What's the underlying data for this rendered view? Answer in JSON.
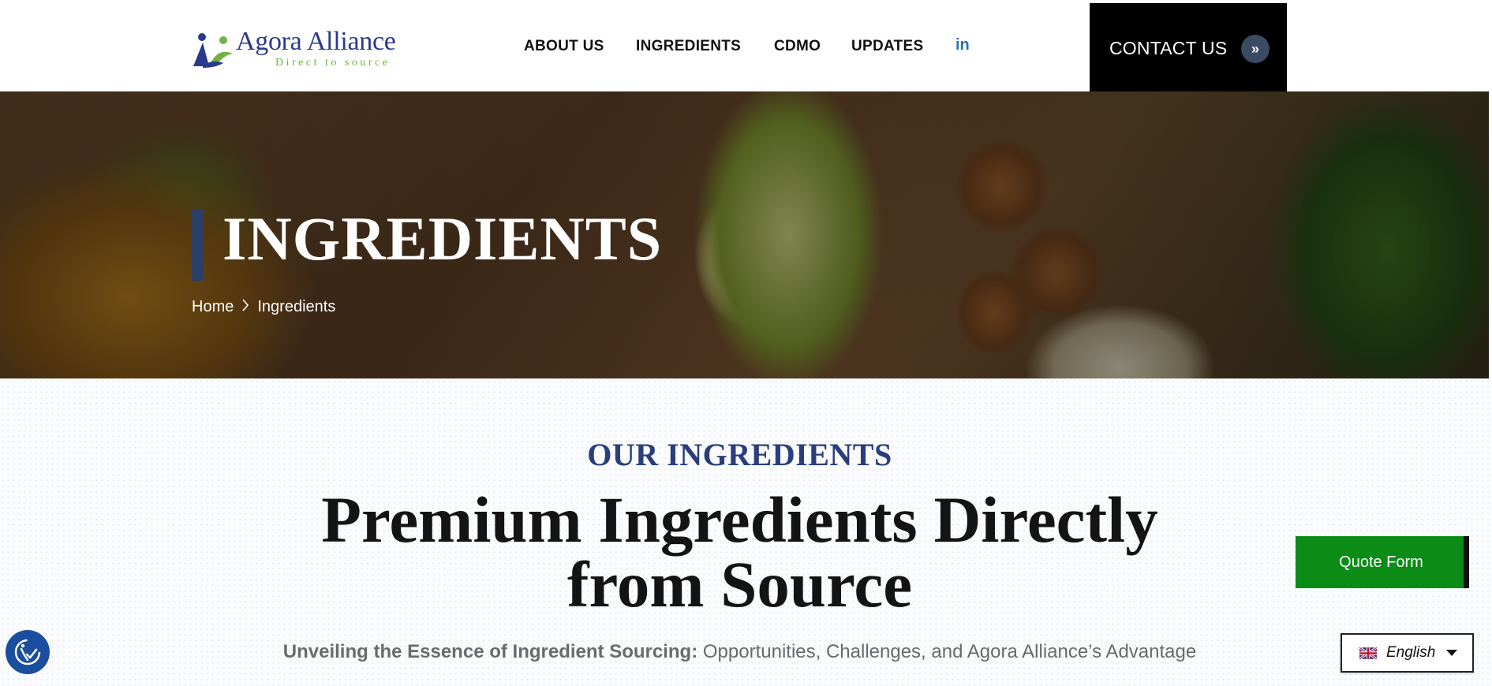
{
  "logo": {
    "name": "Agora Alliance",
    "tagline": "Direct to source"
  },
  "nav": {
    "items": [
      "ABOUT US",
      "INGREDIENTS",
      "CDMO",
      "UPDATES"
    ],
    "linkedin": "in",
    "contact_label": "CONTACT US",
    "contact_icon": "double-chevron-right-icon"
  },
  "hero": {
    "title": "INGREDIENTS",
    "breadcrumb": {
      "home": "Home",
      "separator": ">",
      "current": "Ingredients"
    }
  },
  "main": {
    "eyebrow": "OUR INGREDIENTS",
    "headline_line1": "Premium Ingredients Directly",
    "headline_line2": "from Source",
    "subline_bold": "Unveiling the Essence of Ingredient Sourcing:",
    "subline_rest": " Opportunities, Challenges, and Agora Alliance’s Advantage"
  },
  "widgets": {
    "quote_form_label": "Quote Form",
    "language_label": "English",
    "language_flag": "uk-flag-icon",
    "accessibility_icon": "accessibility-icon"
  },
  "colors": {
    "brand_navy": "#2a3d7c",
    "brand_green": "#6fb33f",
    "quote_green": "#0a8c16",
    "contact_black": "#000000",
    "linkedin_blue": "#2a6fb8"
  }
}
